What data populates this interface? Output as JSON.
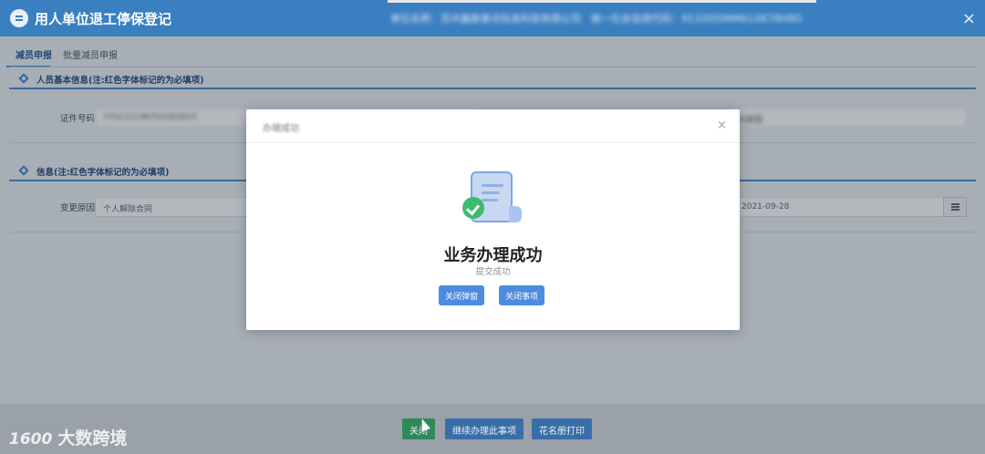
{
  "window": {
    "title": "用人单位退工停保登记",
    "info_text": "单位名称：苏州鑫联泰讯信息科技有限公司　统一社会信用代码：91320506MA1XK78H9G",
    "close_symbol": "×"
  },
  "tabs": [
    {
      "label": "减员申报",
      "active": true
    },
    {
      "label": "批量减员申报",
      "active": false
    }
  ],
  "section_basic": {
    "title": "人员基本信息(注:红色字体标记的为必填项)",
    "id_label": "证件号码",
    "id_value": "370112198703262815",
    "name_value": "刘建国"
  },
  "section_info": {
    "title": "信息(注:红色字体标记的为必填项)",
    "reason_label": "变更原因",
    "reason_value": "个人解除合同",
    "date_value": "2021-09-28"
  },
  "footer": {
    "buttons": [
      "关闭",
      "继续办理此事项",
      "花名册打印"
    ]
  },
  "watermark": {
    "logo": "1600",
    "text": "大数跨境"
  },
  "modal": {
    "title": "办理成功",
    "close_symbol": "×",
    "heading": "业务办理成功",
    "subtext": "提交成功",
    "buttons": [
      "关闭弹窗",
      "关闭事项"
    ]
  },
  "colors": {
    "header": "#3a7fc0",
    "primary_button": "#4d8be0",
    "success_check": "#3fbb6e"
  }
}
